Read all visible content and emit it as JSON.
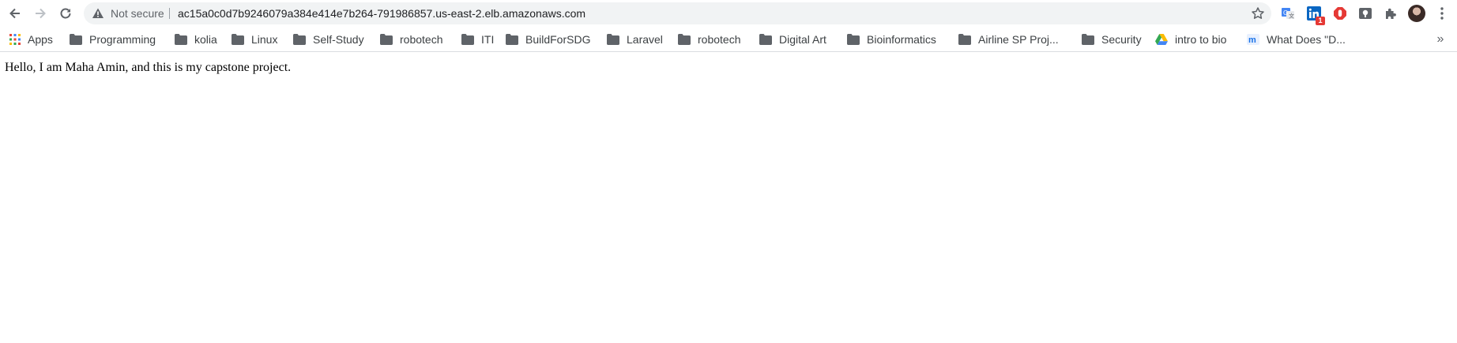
{
  "toolbar": {
    "security_label": "Not secure",
    "url": "ac15a0c0d7b9246079a384e414e7b264-791986857.us-east-2.elb.amazonaws.com",
    "extensions": [
      {
        "name": "translate-icon"
      },
      {
        "name": "linkedin-icon",
        "badge": "1"
      },
      {
        "name": "adblock-icon"
      },
      {
        "name": "extension-icon-gray"
      },
      {
        "name": "puzzle-icon"
      }
    ]
  },
  "bookmarks": [
    {
      "label": "Apps",
      "icon": "apps-grid-icon"
    },
    {
      "label": "Programming",
      "icon": "folder-icon"
    },
    {
      "label": "kolia",
      "icon": "folder-icon"
    },
    {
      "label": "Linux",
      "icon": "folder-icon"
    },
    {
      "label": "Self-Study",
      "icon": "folder-icon"
    },
    {
      "label": "robotech",
      "icon": "folder-icon"
    },
    {
      "label": "ITI",
      "icon": "folder-icon"
    },
    {
      "label": "BuildForSDG",
      "icon": "folder-icon"
    },
    {
      "label": "Laravel",
      "icon": "folder-icon"
    },
    {
      "label": "robotech",
      "icon": "folder-icon"
    },
    {
      "label": "Digital Art",
      "icon": "folder-icon"
    },
    {
      "label": "Bioinformatics",
      "icon": "folder-icon"
    },
    {
      "label": "Airline SP Proj...",
      "icon": "folder-icon"
    },
    {
      "label": "Security",
      "icon": "folder-icon"
    },
    {
      "label": "intro to bio",
      "icon": "google-drive-icon"
    },
    {
      "label": "What Does \"D...",
      "icon": "m-site-icon"
    }
  ],
  "bookmarks_overflow": "»",
  "page": {
    "body_text": "Hello, I am Maha Amin, and this is my capstone project."
  },
  "colors": {
    "omnibox_bg": "#f1f3f4",
    "folder": "#5f6368",
    "linkedin": "#0a66c2",
    "adblock": "#e53935",
    "badge": "#e53935"
  }
}
